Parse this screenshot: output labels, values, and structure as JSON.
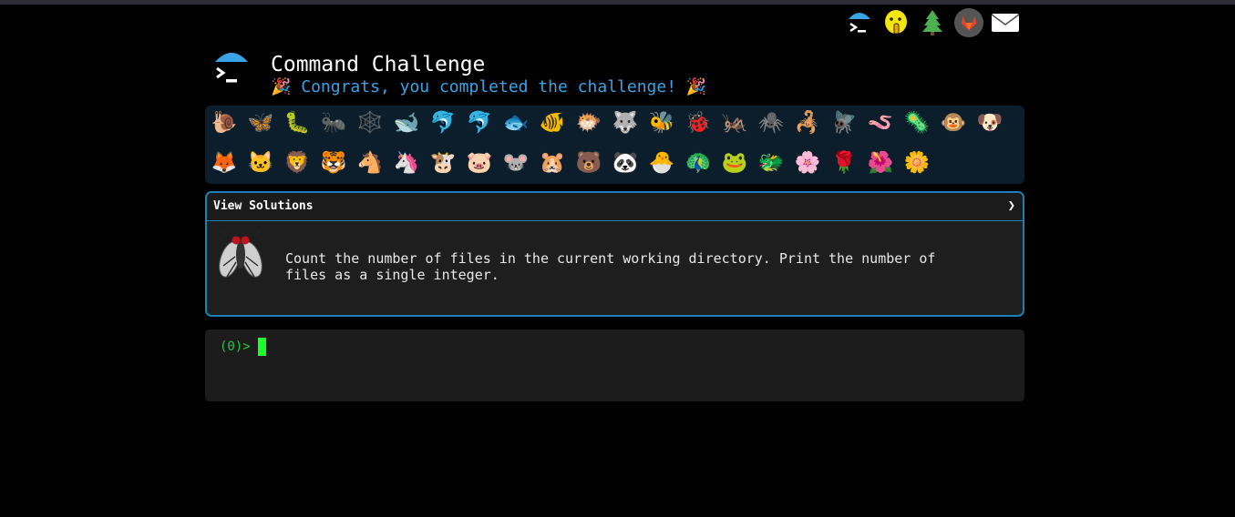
{
  "header": {
    "title": "Command Challenge",
    "subtitle": "🎉 Congrats, you completed the challenge! 🎉"
  },
  "top_icons": [
    "terminal-umbrella-icon",
    "shushing-face-icon",
    "tree-icon",
    "gitlab-icon",
    "envelope-icon"
  ],
  "animals": [
    "🐌",
    "🦋",
    "🐛",
    "🐜",
    "🕸️",
    "🐋",
    "🐬",
    "🐬",
    "🐟",
    "🐠",
    "🐡",
    "🐺",
    "🐝",
    "🐞",
    "🦗",
    "🕷️",
    "🦂",
    "🪰",
    "🪱",
    "🦠",
    "🐵",
    "🐶",
    "🦊",
    "🐱",
    "🦁",
    "🐯",
    "🐴",
    "🦄",
    "🐮",
    "🐷",
    "🐭",
    "🐹",
    "🐻",
    "🐼",
    "🐣",
    "🦚",
    "🐸",
    "🐲",
    "🌸",
    "🌹",
    "🌺",
    "🌼"
  ],
  "solutions": {
    "label": "View Solutions",
    "chevron": "❯"
  },
  "challenge": {
    "icon": "fly-icon",
    "text": "Count the number of files in the current working directory. Print the number of files as a single integer."
  },
  "terminal": {
    "prompt": "(0)>"
  },
  "colors": {
    "accent": "#3aa3e6",
    "panel_border": "#1c7fb8",
    "prompt_green": "#27c93f",
    "cursor_green": "#1aff2a"
  }
}
